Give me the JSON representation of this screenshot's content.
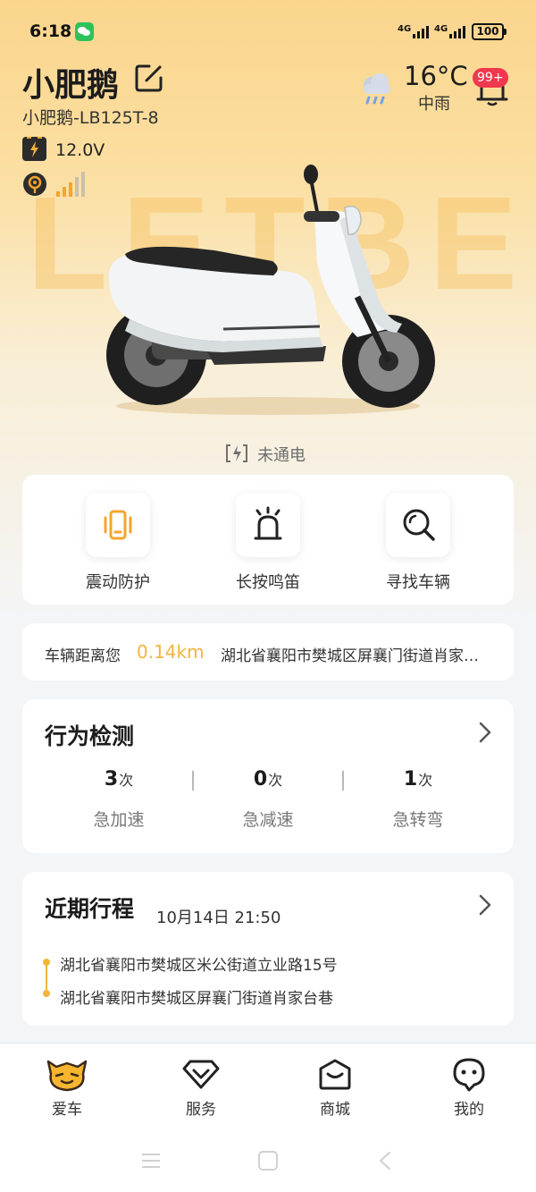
{
  "status_bar": {
    "time": "6:18",
    "network_1": "4G",
    "network_2": "4G",
    "battery": "100"
  },
  "vehicle": {
    "name": "小肥鹅",
    "model": "小肥鹅-LB125T-8",
    "voltage": "12.0V",
    "brand_watermark": "LETBE",
    "power_status": "未通电"
  },
  "weather": {
    "temperature": "16°C",
    "condition": "中雨",
    "icon": "cloud-rain-icon"
  },
  "notifications": {
    "badge": "99+"
  },
  "quick_actions": [
    {
      "label": "震动防护",
      "icon": "phone-vibrate-icon"
    },
    {
      "label": "长按鸣笛",
      "icon": "horn-icon"
    },
    {
      "label": "寻找车辆",
      "icon": "search-icon"
    }
  ],
  "distance": {
    "label": "车辆距离您",
    "value": "0.14km",
    "address": "湖北省襄阳市樊城区屏襄门街道肖家台巷"
  },
  "behavior": {
    "title": "行为检测",
    "unit": "次",
    "stats": [
      {
        "value": "3",
        "label": "急加速"
      },
      {
        "value": "0",
        "label": "急减速"
      },
      {
        "value": "1",
        "label": "急转弯"
      }
    ]
  },
  "trip": {
    "title": "近期行程",
    "time": "10月14日 21:50",
    "start": "湖北省襄阳市樊城区米公街道立业路15号",
    "end": "湖北省襄阳市樊城区屏襄门街道肖家台巷"
  },
  "tabs": [
    {
      "label": "爱车",
      "icon": "mascot-icon",
      "active": true
    },
    {
      "label": "服务",
      "icon": "diamond-icon",
      "active": false
    },
    {
      "label": "商城",
      "icon": "shop-icon",
      "active": false
    },
    {
      "label": "我的",
      "icon": "profile-icon",
      "active": false
    }
  ],
  "colors": {
    "accent": "#f2b53a",
    "badge": "#f0384e",
    "hero_top": "#fbd58d"
  }
}
